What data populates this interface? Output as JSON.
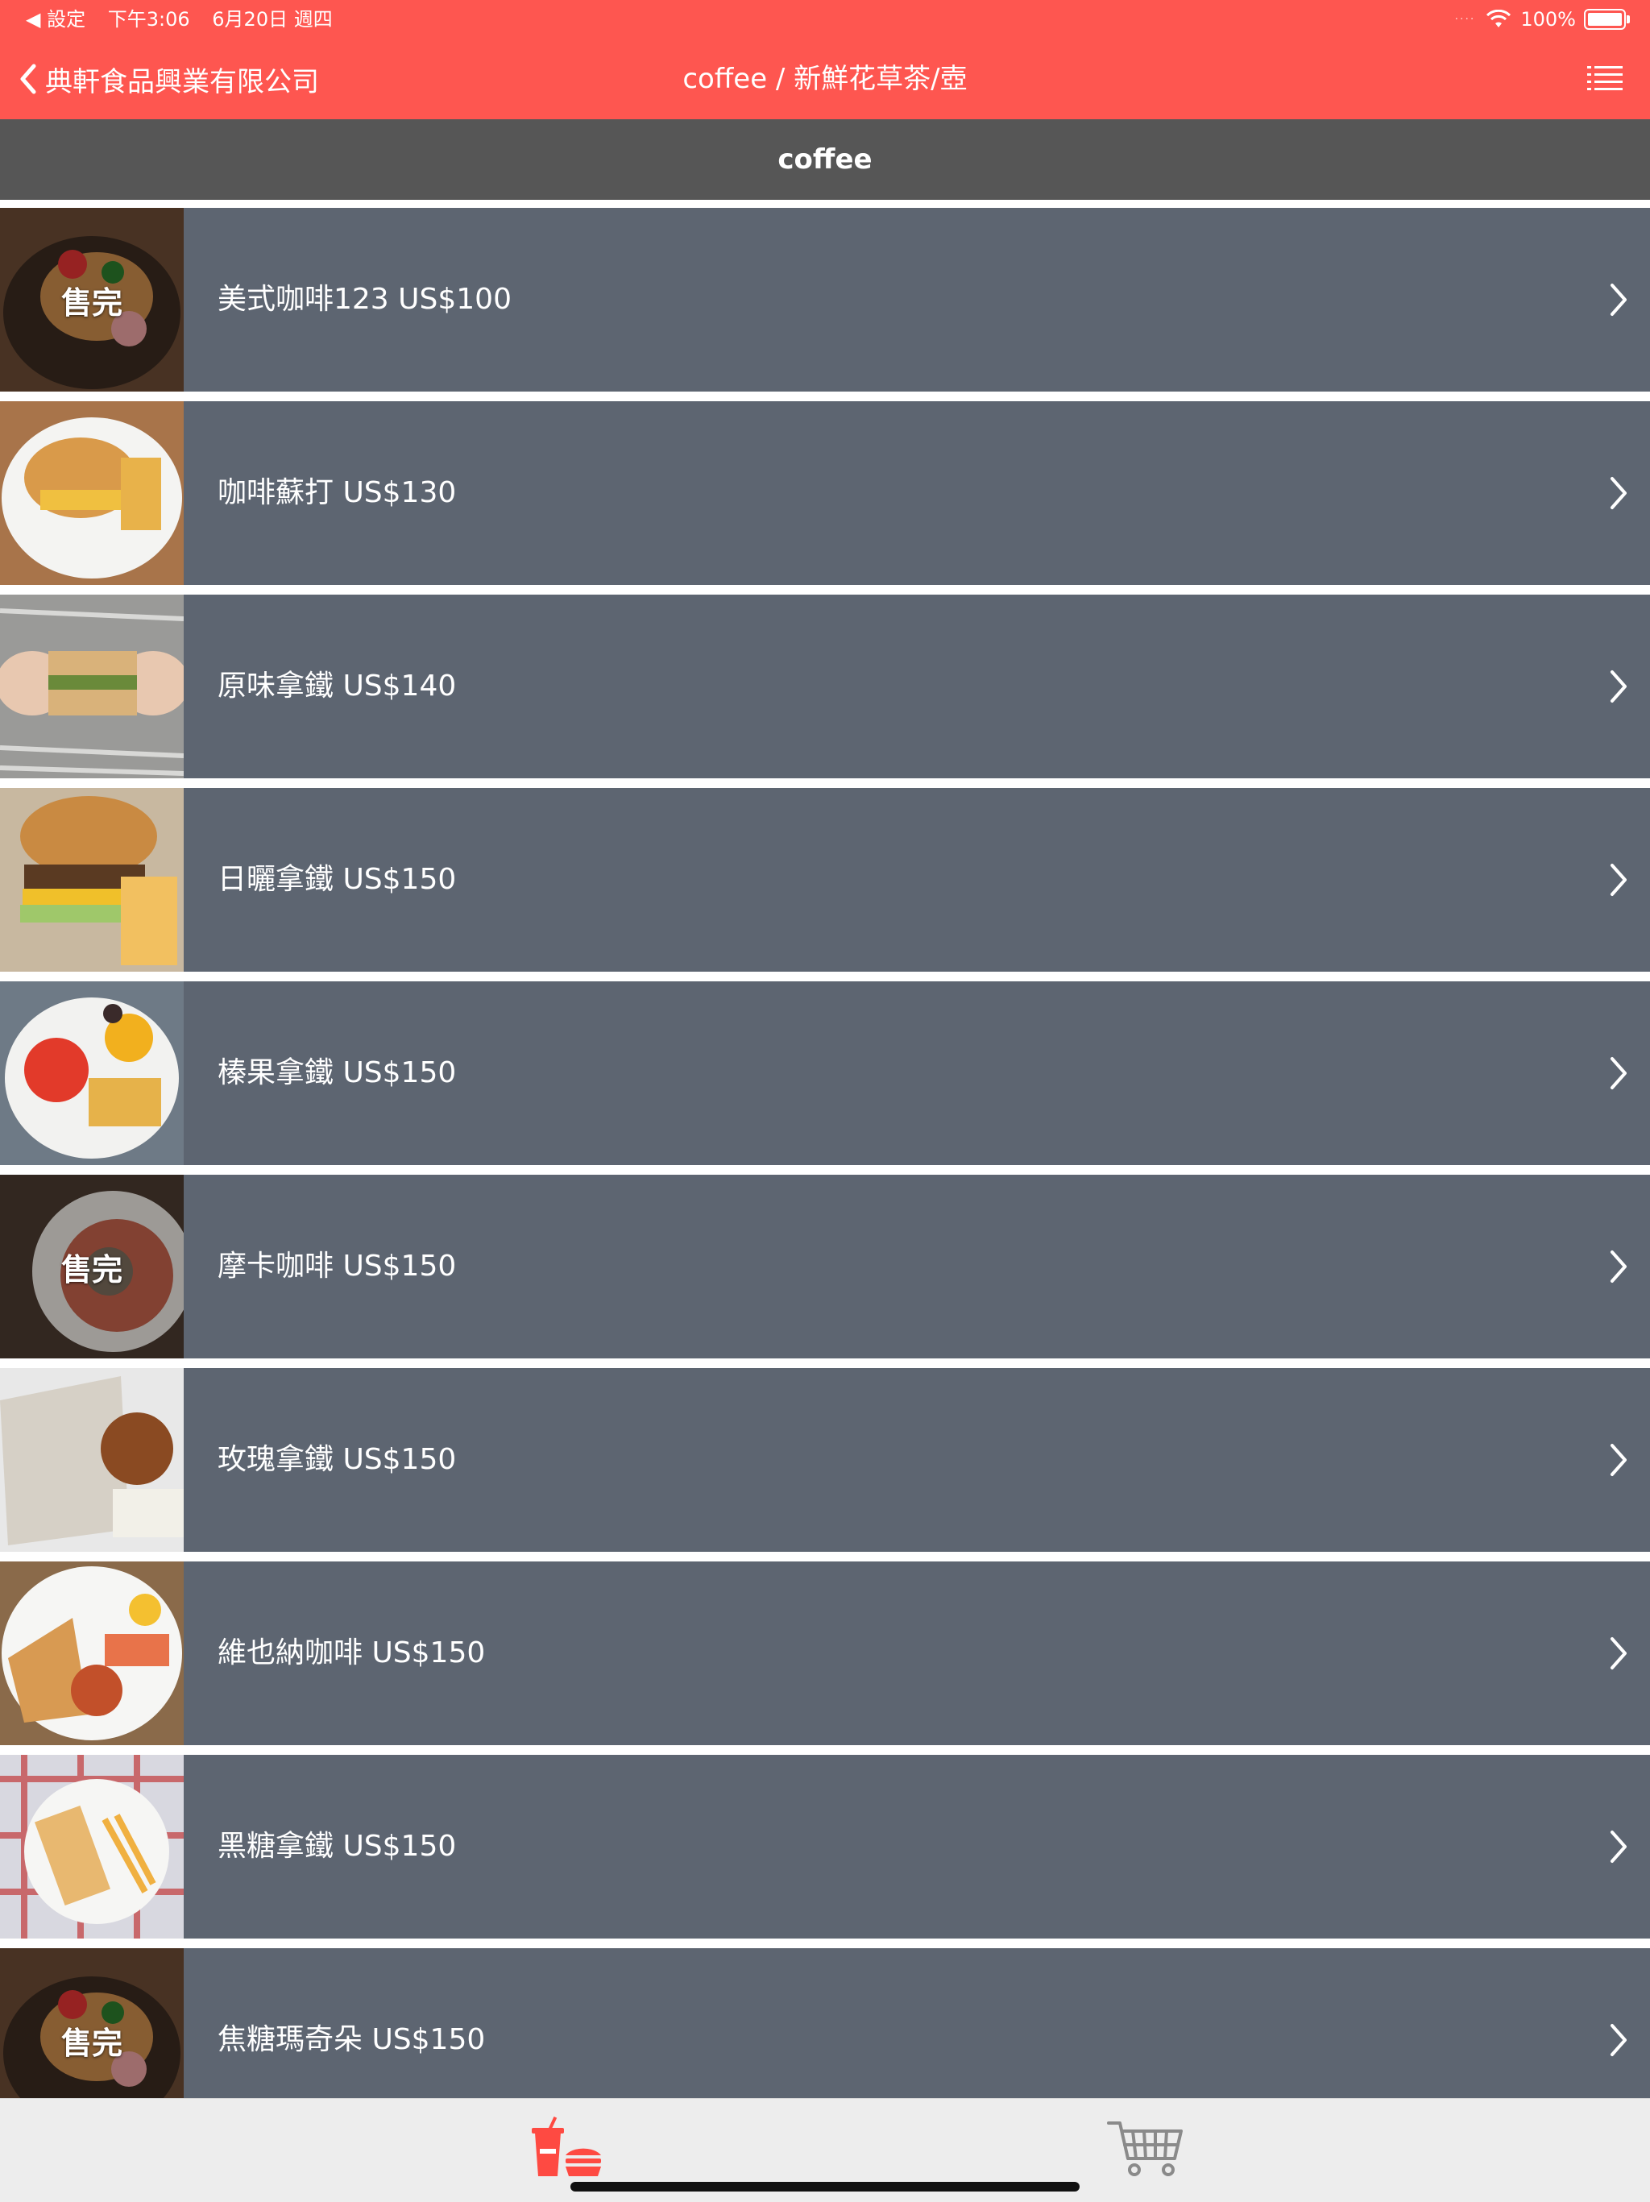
{
  "status_bar": {
    "back_app": "◀ 設定",
    "time": "下午3:06",
    "date": "6月20日 週四",
    "signal": "····",
    "battery": "100%"
  },
  "nav": {
    "back_label": "典軒食品興業有限公司",
    "title": "coffee / 新鮮花草茶/壺"
  },
  "section": {
    "title": "coffee"
  },
  "items": [
    {
      "label": "美式咖啡123 US$100",
      "badge": "售完"
    },
    {
      "label": "咖啡蘇打 US$130",
      "badge": ""
    },
    {
      "label": "原味拿鐵 US$140",
      "badge": ""
    },
    {
      "label": "日曬拿鐵 US$150",
      "badge": ""
    },
    {
      "label": "榛果拿鐵 US$150",
      "badge": ""
    },
    {
      "label": "摩卡咖啡 US$150",
      "badge": "售完"
    },
    {
      "label": "玫瑰拿鐵 US$150",
      "badge": ""
    },
    {
      "label": "維也納咖啡 US$150",
      "badge": ""
    },
    {
      "label": "黑糖拿鐵 US$150",
      "badge": ""
    },
    {
      "label": "焦糖瑪奇朵 US$150",
      "badge": "售完"
    }
  ],
  "tabs": [
    {
      "icon": "food-drink-icon",
      "active": true,
      "color": "#fe4a42"
    },
    {
      "icon": "shopping-cart-icon",
      "active": false,
      "color": "#8a8a8a"
    }
  ],
  "colors": {
    "accent": "#fe5650",
    "section_bg": "#565656",
    "row_bg": "#5d6571"
  }
}
